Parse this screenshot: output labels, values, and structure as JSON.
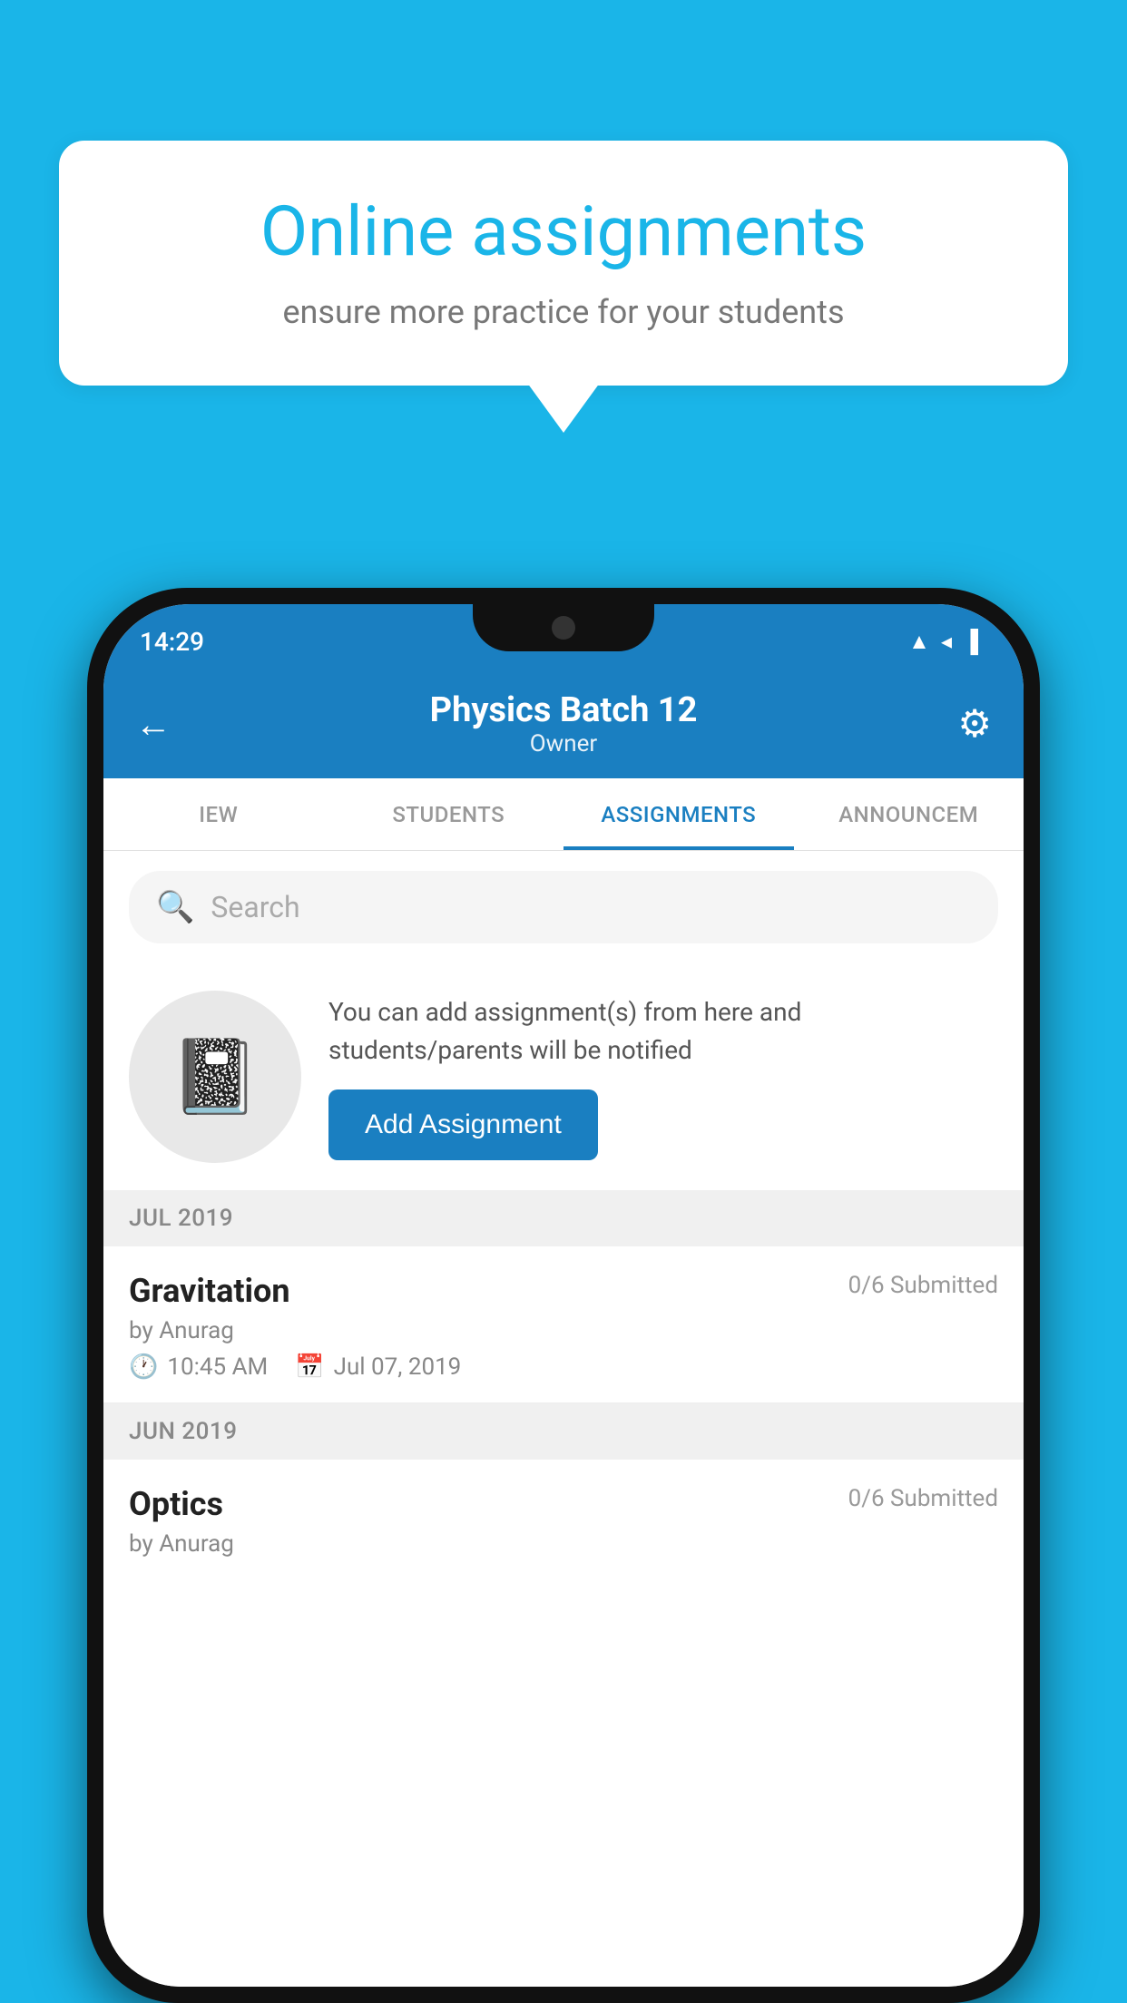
{
  "background_color": "#1ab5e8",
  "speech_bubble": {
    "title": "Online assignments",
    "subtitle": "ensure more practice for your students"
  },
  "status_bar": {
    "time": "14:29",
    "icons": [
      "wifi",
      "signal",
      "battery"
    ]
  },
  "header": {
    "back_label": "←",
    "title": "Physics Batch 12",
    "subtitle": "Owner",
    "settings_label": "⚙"
  },
  "tabs": [
    {
      "label": "IEW",
      "active": false
    },
    {
      "label": "STUDENTS",
      "active": false
    },
    {
      "label": "ASSIGNMENTS",
      "active": true
    },
    {
      "label": "ANNOUNCEM",
      "active": false
    }
  ],
  "search": {
    "placeholder": "Search"
  },
  "promo": {
    "text": "You can add assignment(s) from here and students/parents will be notified",
    "button_label": "Add Assignment"
  },
  "sections": [
    {
      "label": "JUL 2019",
      "assignments": [
        {
          "name": "Gravitation",
          "submitted": "0/6 Submitted",
          "by": "by Anurag",
          "time": "10:45 AM",
          "date": "Jul 07, 2019"
        }
      ]
    },
    {
      "label": "JUN 2019",
      "assignments": [
        {
          "name": "Optics",
          "submitted": "0/6 Submitted",
          "by": "by Anurag",
          "time": "",
          "date": ""
        }
      ]
    }
  ]
}
